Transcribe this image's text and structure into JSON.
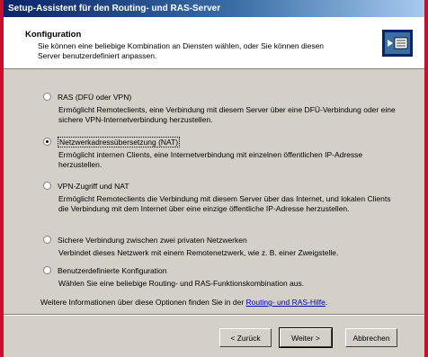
{
  "window": {
    "title": "Setup-Assistent für den Routing- und RAS-Server"
  },
  "header": {
    "title": "Konfiguration",
    "subtitle": "Sie können eine beliebige Kombination an Diensten wählen, oder Sie können diesen Server benutzerdefiniert anpassen."
  },
  "options": [
    {
      "label": "RAS (DFÜ oder VPN)",
      "description": "Ermöglicht Remoteclients, eine Verbindung mit diesem Server über eine DFÜ-Verbindung oder eine sichere VPN-Internetverbindung herzustellen.",
      "selected": false
    },
    {
      "label": "Netzwerkadressübersetzung (NAT)",
      "description": "Ermöglicht internen Clients, eine Internetverbindung mit einzelnen öffentlichen IP-Adresse herzustellen.",
      "selected": true
    },
    {
      "label": "VPN-Zugriff und NAT",
      "description": "Ermöglicht Remoteclients die Verbindung mit diesem Server über das Internet, und lokalen Clients die Verbindung mit dem Internet über eine einzige öffentliche IP-Adresse herzustellen.",
      "selected": false
    },
    {
      "label": "Sichere Verbindung zwischen zwei privaten Netzwerken",
      "description": "Verbindet dieses Netzwerk mit einem Remotenetzwerk, wie z. B. einer Zweigstelle.",
      "selected": false
    },
    {
      "label": "Benutzerdefinierte Konfiguration",
      "description": "Wählen Sie eine beliebige Routing- und RAS-Funktionskombination aus.",
      "selected": false
    }
  ],
  "info": {
    "text": "Weitere Informationen über diese Optionen finden Sie in der ",
    "link": "Routing- und RAS-Hilfe",
    "suffix": "."
  },
  "buttons": {
    "back": "< Zurück",
    "next": "Weiter >",
    "cancel": "Abbrechen"
  },
  "colors": {
    "titlebar_start": "#0a246a",
    "titlebar_end": "#a6caf0",
    "dialog_bg": "#d4d0c8",
    "link": "#0000c0"
  }
}
